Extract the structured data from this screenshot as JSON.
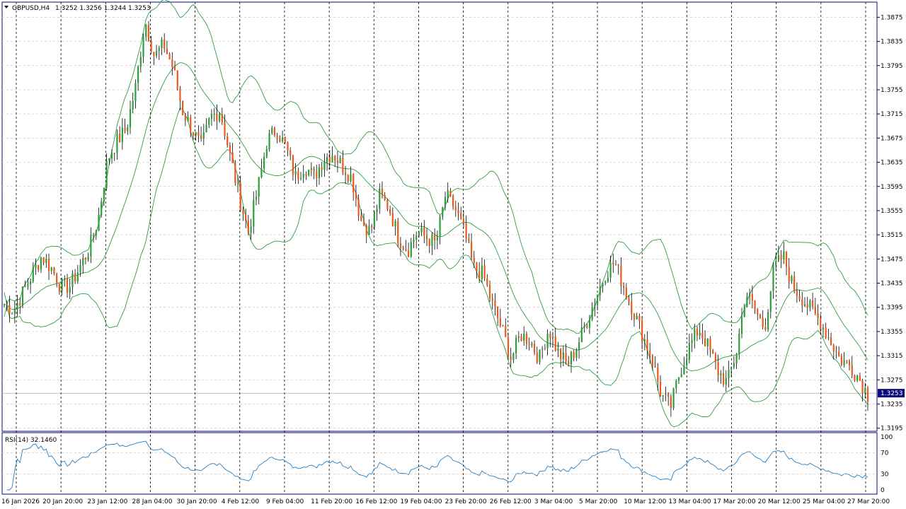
{
  "header": {
    "symbol": "GBPUSD,H4",
    "ohlc": "1.3252 1.3256 1.3244 1.3253",
    "rsi_label": "RSI(14) 32.1460"
  },
  "colors": {
    "bull": "#2e9e3e",
    "bear": "#ec5a1c",
    "bands": "#2e9e3e",
    "rsi": "#1f7ec6",
    "grid": "#c8c8c8",
    "frame": "#0a0a7a",
    "price_tag": "#0a0a7a"
  },
  "chart_data": {
    "type": "candlestick",
    "title": "GBPUSD,H4",
    "price_ylim": [
      1.319,
      1.39
    ],
    "price_ticks": [
      "1.3875",
      "1.3835",
      "1.3795",
      "1.3755",
      "1.3715",
      "1.3675",
      "1.3635",
      "1.3595",
      "1.3555",
      "1.3515",
      "1.3475",
      "1.3435",
      "1.3395",
      "1.3355",
      "1.3315",
      "1.3275",
      "1.3235",
      "1.3195"
    ],
    "current_price": "1.3253",
    "x_labels": [
      "16 Jan 2026",
      "20 Jan 20:00",
      "23 Jan 12:00",
      "28 Jan 04:00",
      "30 Jan 20:00",
      "4 Feb 12:00",
      "9 Feb 04:00",
      "11 Feb 20:00",
      "16 Feb 12:00",
      "19 Feb 04:00",
      "23 Feb 20:00",
      "26 Feb 12:00",
      "3 Mar 04:00",
      "5 Mar 20:00",
      "10 Mar 12:00",
      "13 Mar 04:00",
      "17 Mar 20:00",
      "20 Mar 12:00",
      "25 Mar 04:00",
      "27 Mar 20:00"
    ],
    "close_path": [
      1.34,
      1.339,
      1.342,
      1.345,
      1.348,
      1.346,
      1.343,
      1.343,
      1.346,
      1.349,
      1.354,
      1.364,
      1.367,
      1.369,
      1.376,
      1.387,
      1.381,
      1.383,
      1.379,
      1.372,
      1.369,
      1.366,
      1.371,
      1.372,
      1.365,
      1.358,
      1.352,
      1.359,
      1.367,
      1.369,
      1.366,
      1.361,
      1.363,
      1.361,
      1.364,
      1.365,
      1.363,
      1.361,
      1.354,
      1.352,
      1.358,
      1.356,
      1.351,
      1.349,
      1.352,
      1.351,
      1.35,
      1.358,
      1.356,
      1.352,
      1.346,
      1.345,
      1.34,
      1.336,
      1.331,
      1.335,
      1.334,
      1.331,
      1.336,
      1.332,
      1.33,
      1.333,
      1.337,
      1.341,
      1.345,
      1.347,
      1.343,
      1.339,
      1.335,
      1.331,
      1.325,
      1.323,
      1.329,
      1.333,
      1.336,
      1.333,
      1.329,
      1.327,
      1.332,
      1.342,
      1.339,
      1.336,
      1.346,
      1.348,
      1.343,
      1.341,
      1.339,
      1.337,
      1.334,
      1.331,
      1.33,
      1.328,
      1.325
    ],
    "close_points": 93,
    "series": [
      {
        "name": "",
        "kind": "bollinger",
        "color": "#2e9e3e"
      },
      {
        "name": "",
        "kind": "rsi",
        "color": "#1f7ec6"
      }
    ],
    "rsi_ylim": [
      0,
      100
    ],
    "rsi_ticks": [
      "100",
      "70",
      "30",
      "0"
    ],
    "grid": true
  }
}
